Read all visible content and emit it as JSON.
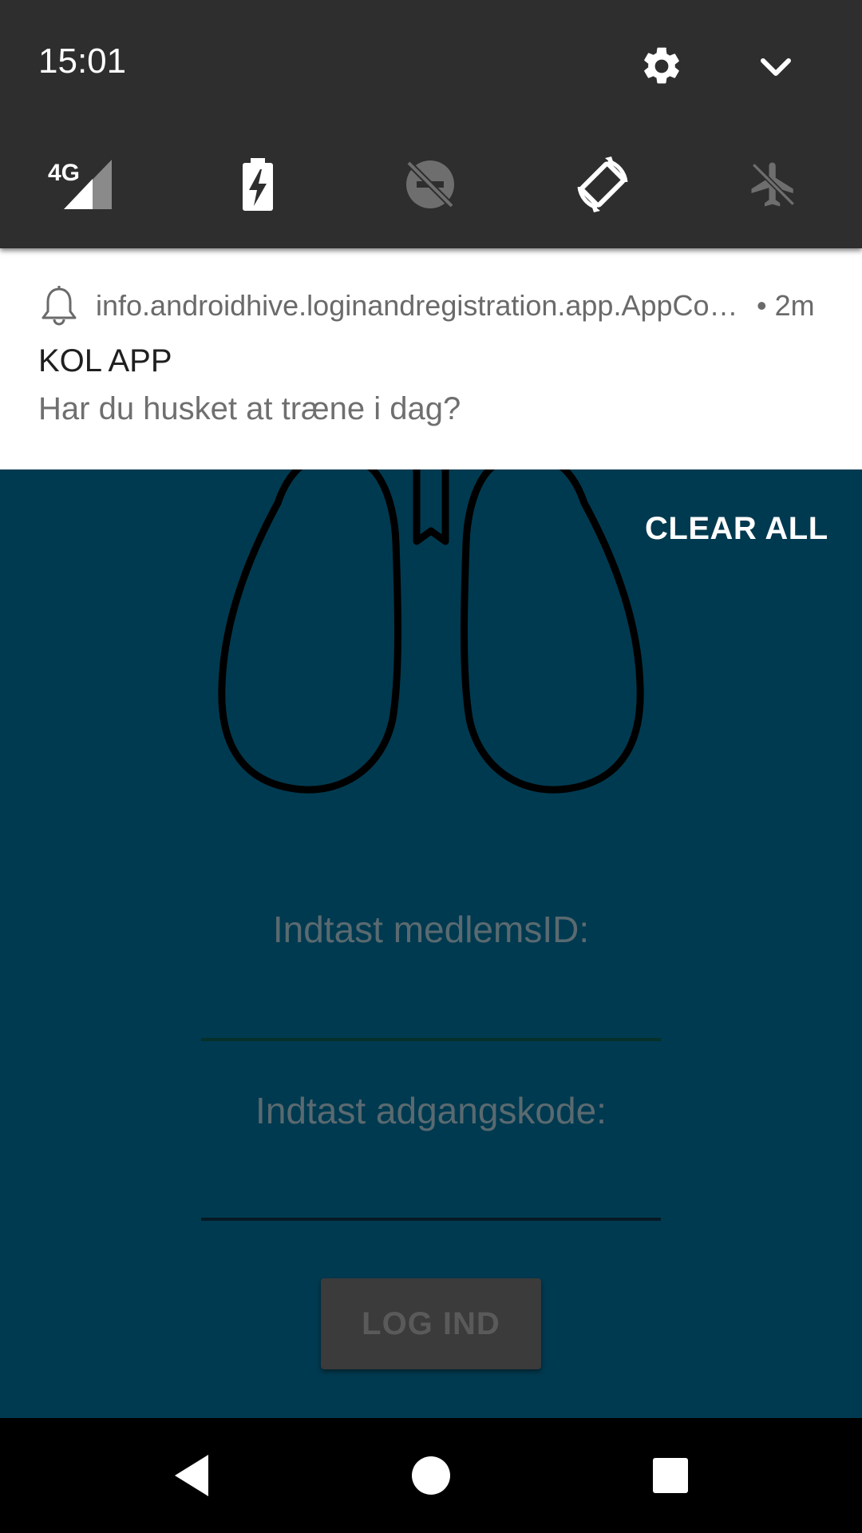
{
  "status": {
    "time": "15:01"
  },
  "quick_settings": {
    "tiles": [
      {
        "icon": "signal-4g-icon",
        "label": "4G"
      },
      {
        "icon": "battery-saver-icon"
      },
      {
        "icon": "do-not-disturb-off-icon"
      },
      {
        "icon": "auto-rotate-icon"
      },
      {
        "icon": "airplane-mode-icon"
      }
    ]
  },
  "notification": {
    "app_name": "info.androidhive.loginandregistration.app.AppCo…",
    "time": "• 2m",
    "title": "KOL APP",
    "text": "Har du husket at træne i dag?"
  },
  "shade": {
    "clear_all": "CLEAR ALL"
  },
  "login": {
    "member_label": "Indtast medlemsID:",
    "password_label": "Indtast adgangskode:",
    "button": "LOG IND"
  },
  "colors": {
    "app_bg": "#003a50",
    "quick_settings_bg": "#2e2e2e",
    "notification_bg": "#ffffff",
    "navbar_bg": "#000000"
  }
}
